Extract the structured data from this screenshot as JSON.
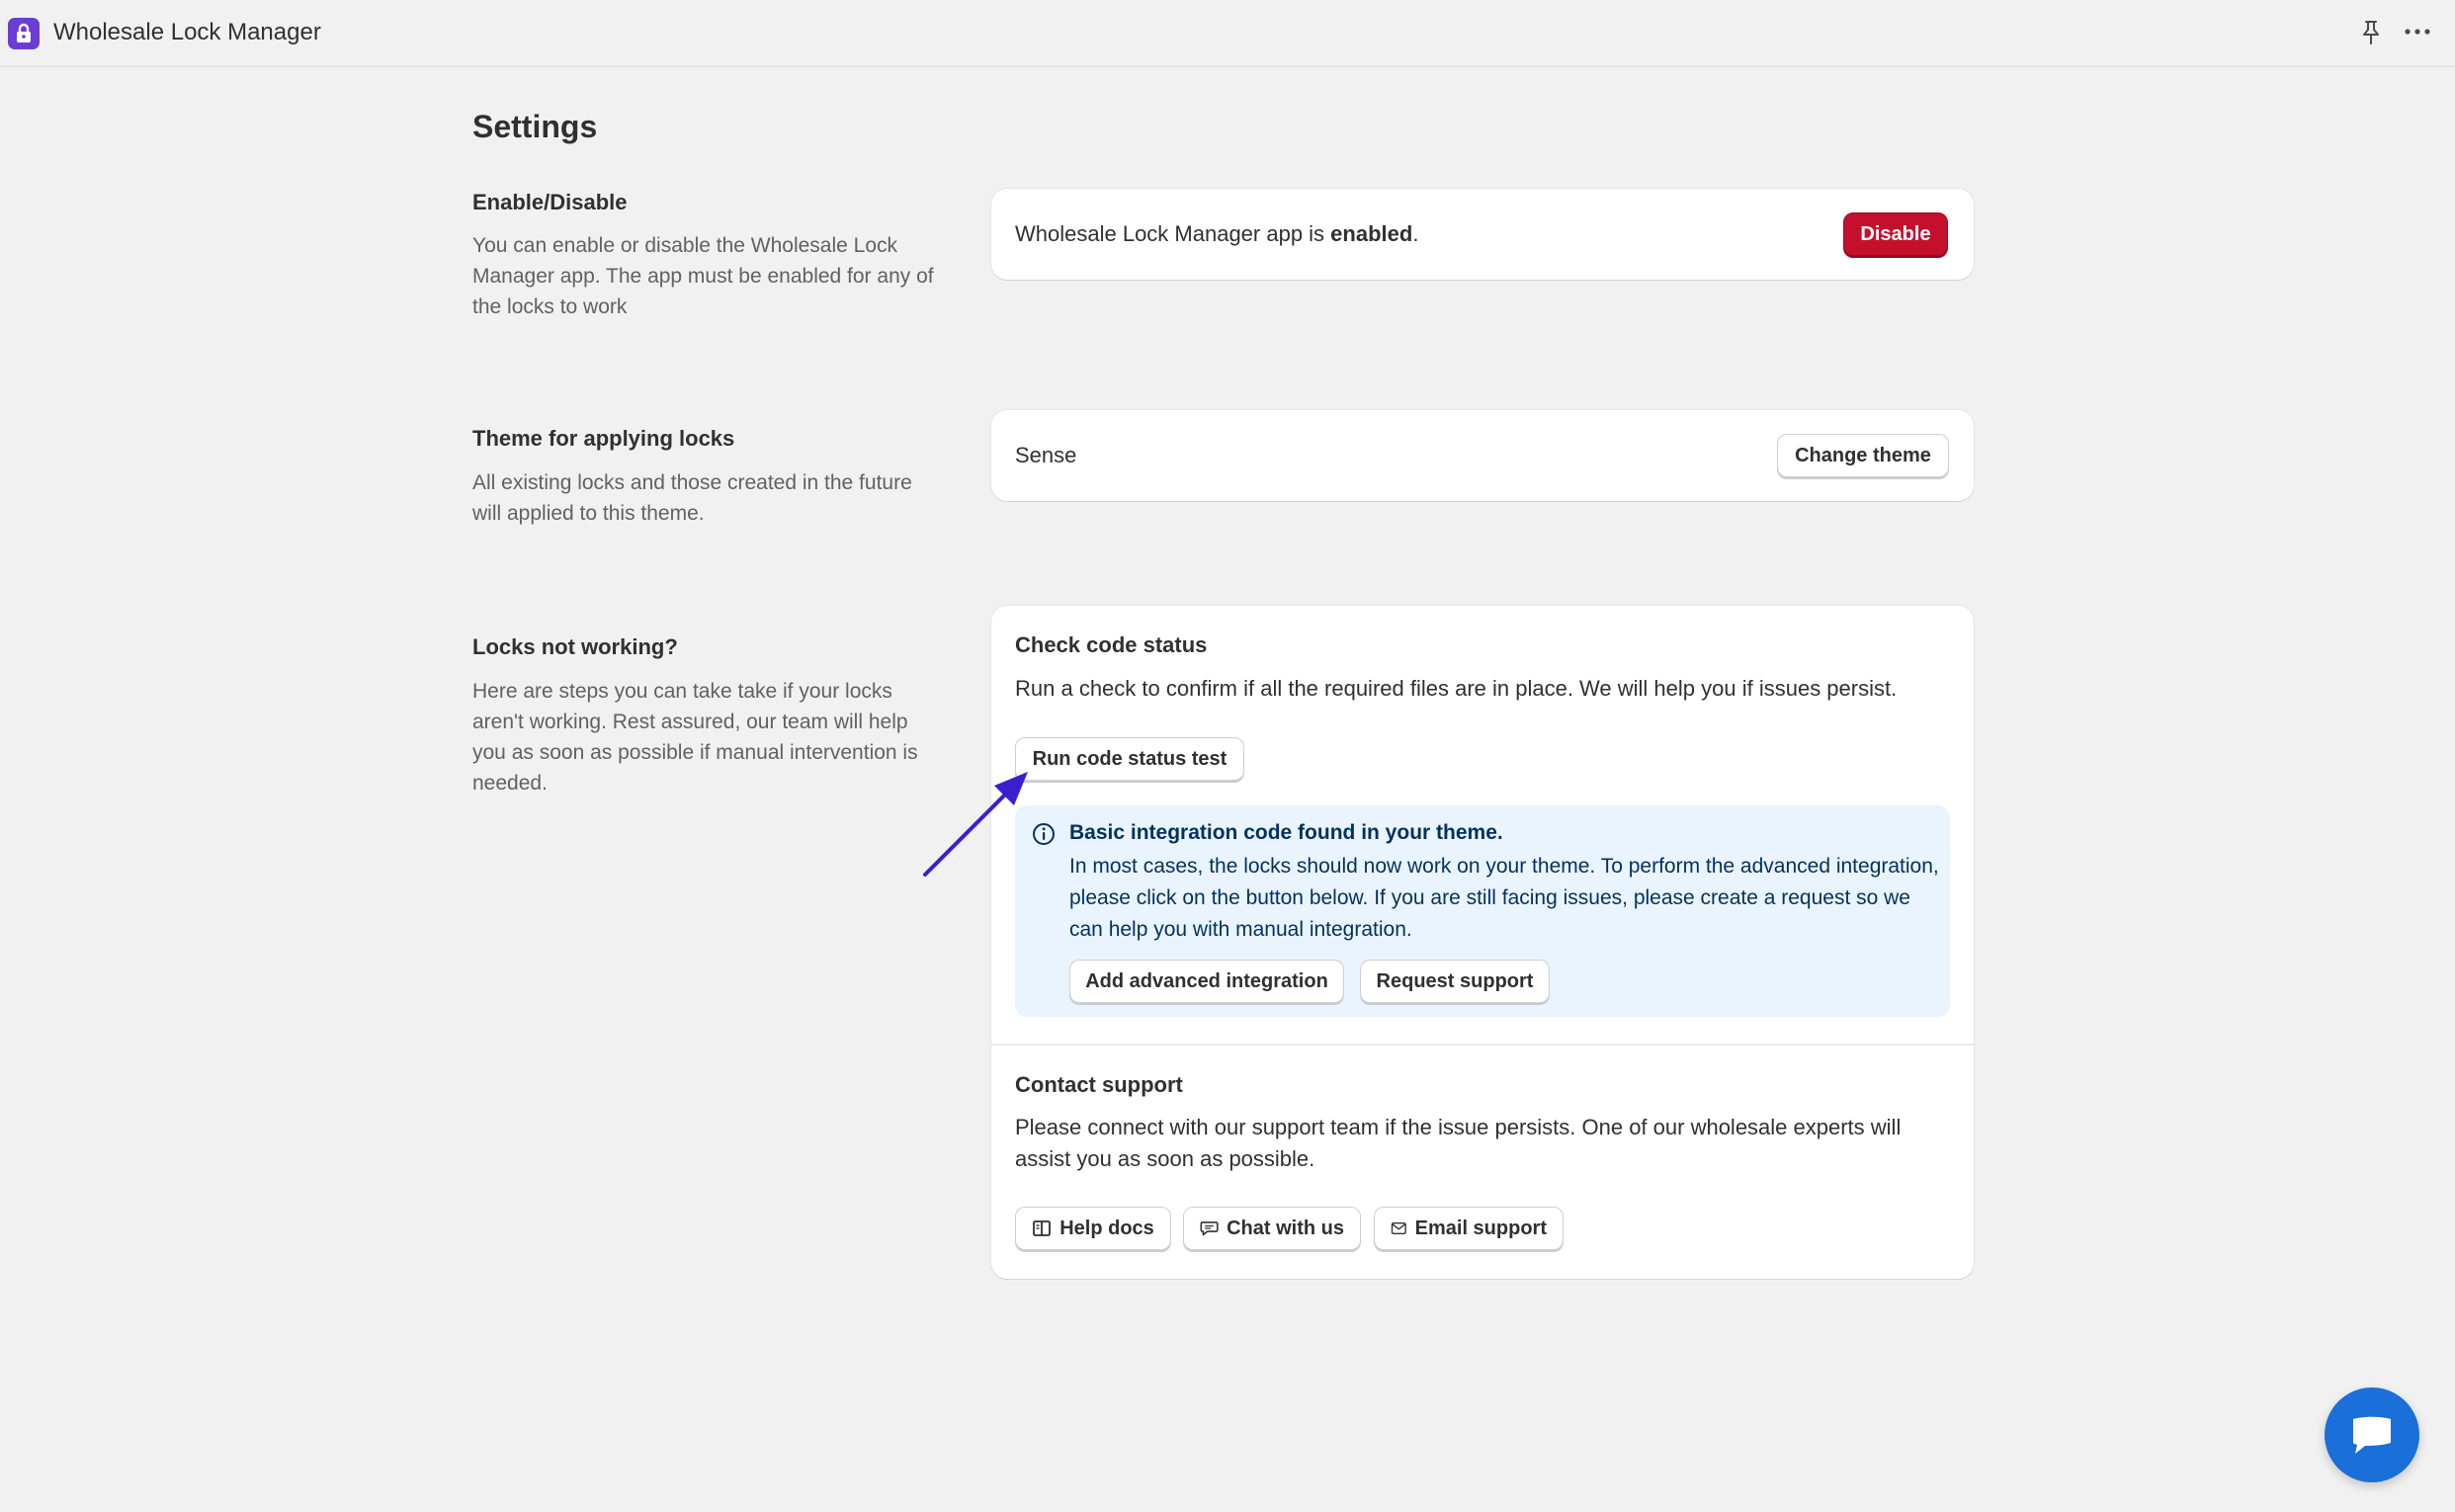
{
  "app": {
    "title": "Wholesale Lock Manager",
    "logo_icon": "lock-icon",
    "accent_color": "#6a3dd6"
  },
  "page": {
    "title": "Settings"
  },
  "enable_section": {
    "heading": "Enable/Disable",
    "description": "You can enable or disable the Wholesale Lock Manager app. The app must be enabled for any of the locks to work",
    "status_prefix": "Wholesale Lock Manager app is ",
    "status_value": "enabled",
    "status_suffix": ".",
    "disable_label": "Disable",
    "danger_color": "#c5102d"
  },
  "theme_section": {
    "heading": "Theme for applying locks",
    "description": "All existing locks and those created in the future will applied to this theme.",
    "current_theme": "Sense",
    "change_label": "Change theme"
  },
  "locks_section": {
    "heading": "Locks not working?",
    "description": "Here are steps you can take take if your locks aren't working. Rest assured, our team will help you as soon as possible if manual intervention is needed.",
    "check": {
      "title": "Check code status",
      "text": "Run a check to confirm if all the required files are in place. We will help you if issues persist.",
      "run_label": "Run code status test"
    },
    "banner": {
      "icon": "info-icon",
      "title": "Basic integration code found in your theme.",
      "text": "In most cases, the locks should now work on your theme. To perform the advanced integration, please click on the button below. If you are still facing issues, please create a request so we can help you with manual integration.",
      "advanced_label": "Add advanced integration",
      "request_label": "Request support",
      "bg_color": "#eaf4ff"
    },
    "contact": {
      "title": "Contact support",
      "text": "Please connect with our support team if the issue persists. One of our wholesale experts will assist you as soon as possible.",
      "help_label": "Help docs",
      "chat_label": "Chat with us",
      "email_label": "Email support"
    }
  },
  "annotation": {
    "arrow_color": "#3a1fd0"
  },
  "chat_widget": {
    "icon": "chat-bubble-icon",
    "color": "#1a6fd9"
  }
}
